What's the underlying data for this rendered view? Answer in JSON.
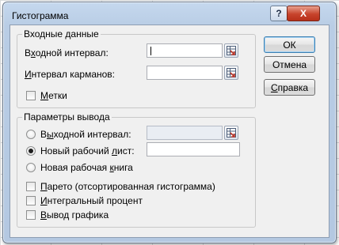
{
  "dialog": {
    "title": "Гистограмма",
    "help_glyph": "?",
    "close_glyph": "X"
  },
  "input_group": {
    "legend": "Входные данные",
    "input_range": {
      "pre": "В",
      "ul": "х",
      "post": "одной интервал:",
      "value": ""
    },
    "bin_range": {
      "pre": "",
      "ul": "И",
      "post": "нтервал карманов:",
      "value": ""
    },
    "labels_checkbox": {
      "pre": "",
      "ul": "М",
      "post": "етки",
      "checked": false
    }
  },
  "output_group": {
    "legend": "Параметры вывода",
    "output_range": {
      "pre": "В",
      "ul": "ы",
      "post": "ходной интервал:",
      "value": "",
      "selected": false,
      "enabled": false
    },
    "new_sheet": {
      "pre": "Новый рабочий ",
      "ul": "л",
      "post": "ист:",
      "value": "",
      "selected": true
    },
    "new_workbook": {
      "pre": "Новая рабочая ",
      "ul": "к",
      "post": "нига",
      "selected": false
    },
    "pareto": {
      "pre": "",
      "ul": "П",
      "post": "арето (отсортированная гистограмма)",
      "checked": false
    },
    "cumulative_percent": {
      "pre": "",
      "ul": "И",
      "post": "нтегральный процент",
      "checked": false
    },
    "chart_output": {
      "pre": "",
      "ul": "В",
      "post": "ывод графика",
      "checked": false
    }
  },
  "buttons": {
    "ok": {
      "pre": "",
      "ul": "",
      "post": "ОК"
    },
    "cancel": {
      "pre": "",
      "ul": "",
      "post": "Отмена"
    },
    "help": {
      "pre": "",
      "ul": "С",
      "post": "правка"
    }
  },
  "colors": {
    "frame": "#b9cde5",
    "client": "#f0f0f0",
    "close_button": "#c7432b"
  }
}
